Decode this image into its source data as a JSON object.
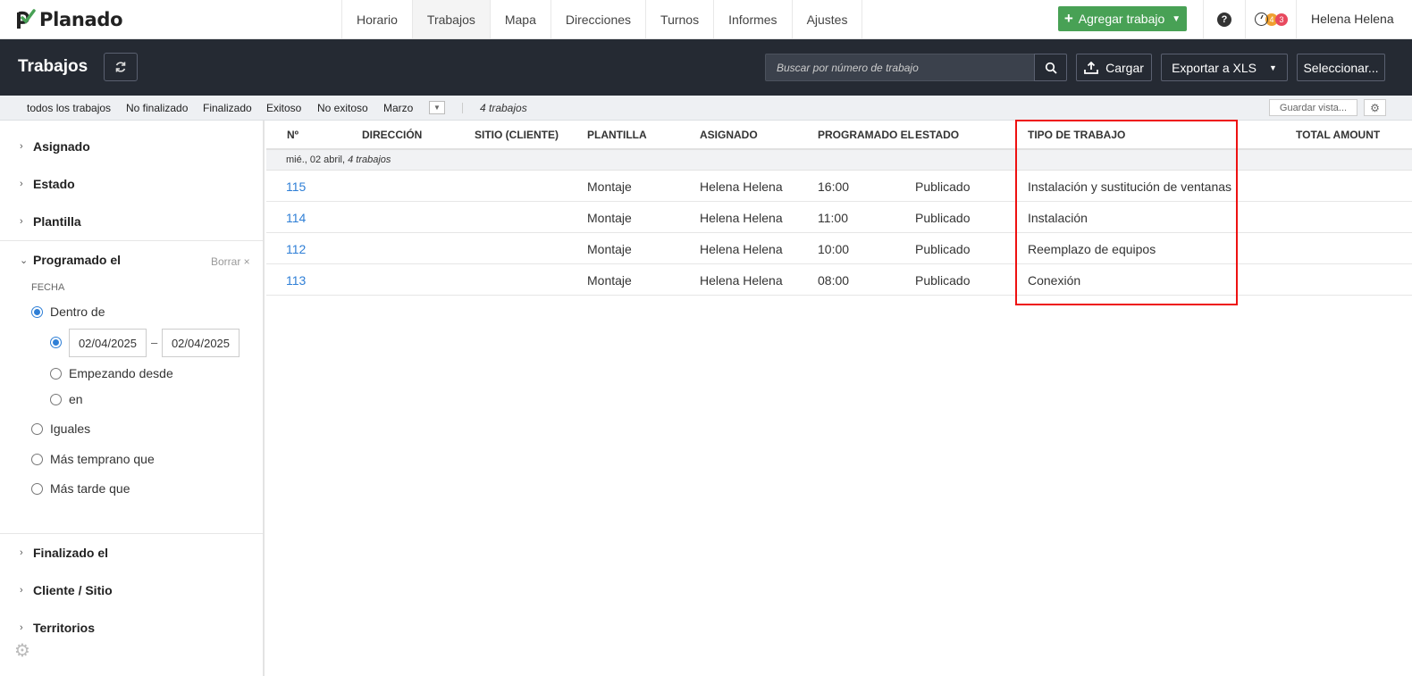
{
  "brand": {
    "name": "Planado",
    "accent": "#48a155",
    "highlight": "#ee1111"
  },
  "nav": {
    "items": [
      {
        "label": "Horario",
        "active": false
      },
      {
        "label": "Trabajos",
        "active": true
      },
      {
        "label": "Mapa",
        "active": false
      },
      {
        "label": "Direcciones",
        "active": false
      },
      {
        "label": "Turnos",
        "active": false
      },
      {
        "label": "Informes",
        "active": false
      },
      {
        "label": "Ajustes",
        "active": false
      }
    ],
    "add_job_label": "Agregar trabajo",
    "help_label": "?",
    "badge_orange": "4",
    "badge_red": "3",
    "user_name": "Helena Helena"
  },
  "header": {
    "title": "Trabajos",
    "search_placeholder": "Buscar por número de trabajo",
    "upload_label": "Cargar",
    "export_label": "Exportar a XLS",
    "select_label": "Seleccionar..."
  },
  "filters": {
    "all": "todos los trabajos",
    "not_finished": "No finalizado",
    "finished": "Finalizado",
    "success": "Exitoso",
    "not_success": "No exitoso",
    "month": "Marzo",
    "count": "4 trabajos",
    "save_view": "Guardar vista..."
  },
  "sidebar": {
    "assigned": "Asignado",
    "status": "Estado",
    "template": "Plantilla",
    "scheduled": "Programado el",
    "clear": "Borrar ×",
    "date_label": "FECHA",
    "within": "Dentro de",
    "date_from": "02/04/2025",
    "date_dash": "–",
    "date_to": "02/04/2025",
    "starting_from": "Empezando desde",
    "on": "en",
    "equals": "Iguales",
    "earlier": "Más temprano que",
    "later": "Más tarde que",
    "finished_on": "Finalizado el",
    "client_site": "Cliente / Sitio",
    "territories": "Territorios"
  },
  "table": {
    "headers": {
      "num": "Nº",
      "address": "DIRECCIÓN",
      "site": "SITIO (CLIENTE)",
      "template": "PLANTILLA",
      "assigned": "ASIGNADO",
      "scheduled": "PROGRAMADO EL",
      "status": "ESTADO",
      "job_type": "TIPO DE TRABAJO",
      "total": "TOTAL AMOUNT"
    },
    "group": {
      "date": "mié., 02 abril",
      "count": "4 trabajos"
    },
    "rows": [
      {
        "num": "115",
        "template": "Montaje",
        "assigned": "Helena Helena",
        "time": "16:00",
        "status": "Publicado",
        "job_type": "Instalación y sustitución de ventanas"
      },
      {
        "num": "114",
        "template": "Montaje",
        "assigned": "Helena Helena",
        "time": "11:00",
        "status": "Publicado",
        "job_type": "Instalación"
      },
      {
        "num": "112",
        "template": "Montaje",
        "assigned": "Helena Helena",
        "time": "10:00",
        "status": "Publicado",
        "job_type": "Reemplazo de equipos"
      },
      {
        "num": "113",
        "template": "Montaje",
        "assigned": "Helena Helena",
        "time": "08:00",
        "status": "Publicado",
        "job_type": "Conexión"
      }
    ]
  }
}
